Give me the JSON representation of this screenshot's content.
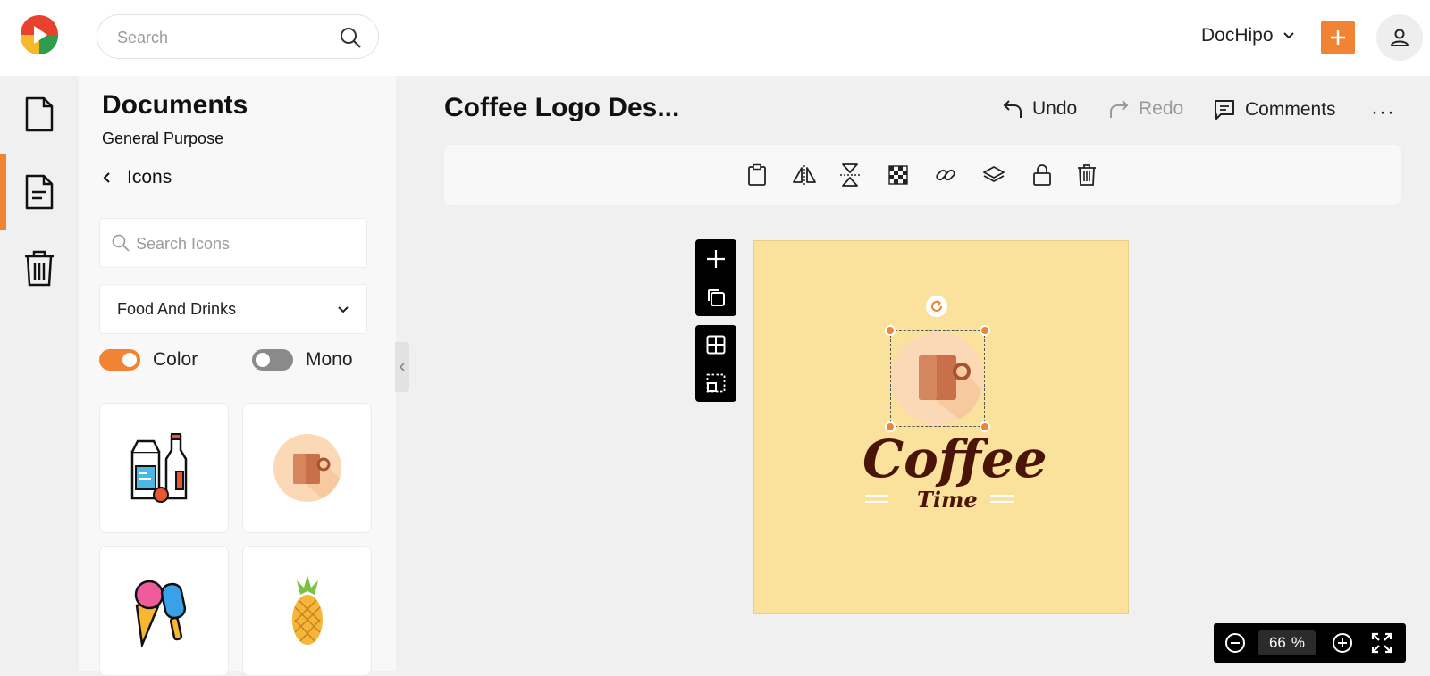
{
  "header": {
    "search_placeholder": "Search",
    "brand": "DocHipo",
    "accent_color": "#f08434"
  },
  "rail": {
    "items": [
      {
        "name": "documents",
        "icon": "file-icon"
      },
      {
        "name": "templates",
        "icon": "file-text-icon",
        "active": true
      },
      {
        "name": "trash",
        "icon": "trash-icon"
      }
    ]
  },
  "panel": {
    "title": "Documents",
    "subtitle": "General Purpose",
    "back_label": "Icons",
    "icon_search_placeholder": "Search Icons",
    "category": "Food And Drinks",
    "toggle_color_label": "Color",
    "toggle_mono_label": "Mono",
    "color_on": true,
    "tiles": [
      "milk-bottles-icon",
      "coffee-cup-icon",
      "ice-cream-icon",
      "pineapple-icon"
    ]
  },
  "editor": {
    "doc_title": "Coffee Logo Des...",
    "undo_label": "Undo",
    "redo_label": "Redo",
    "comments_label": "Comments",
    "more_label": "···"
  },
  "toolbar": {
    "tools": [
      "clipboard-icon",
      "flip-horizontal-icon",
      "flip-vertical-icon",
      "transparency-icon",
      "link-icon",
      "layers-icon",
      "lock-icon",
      "trash-icon"
    ]
  },
  "canvas": {
    "heading": "Coffee",
    "subheading": "Time",
    "background": "#fbe29c"
  },
  "zoom": {
    "value": "66",
    "unit": "%"
  }
}
